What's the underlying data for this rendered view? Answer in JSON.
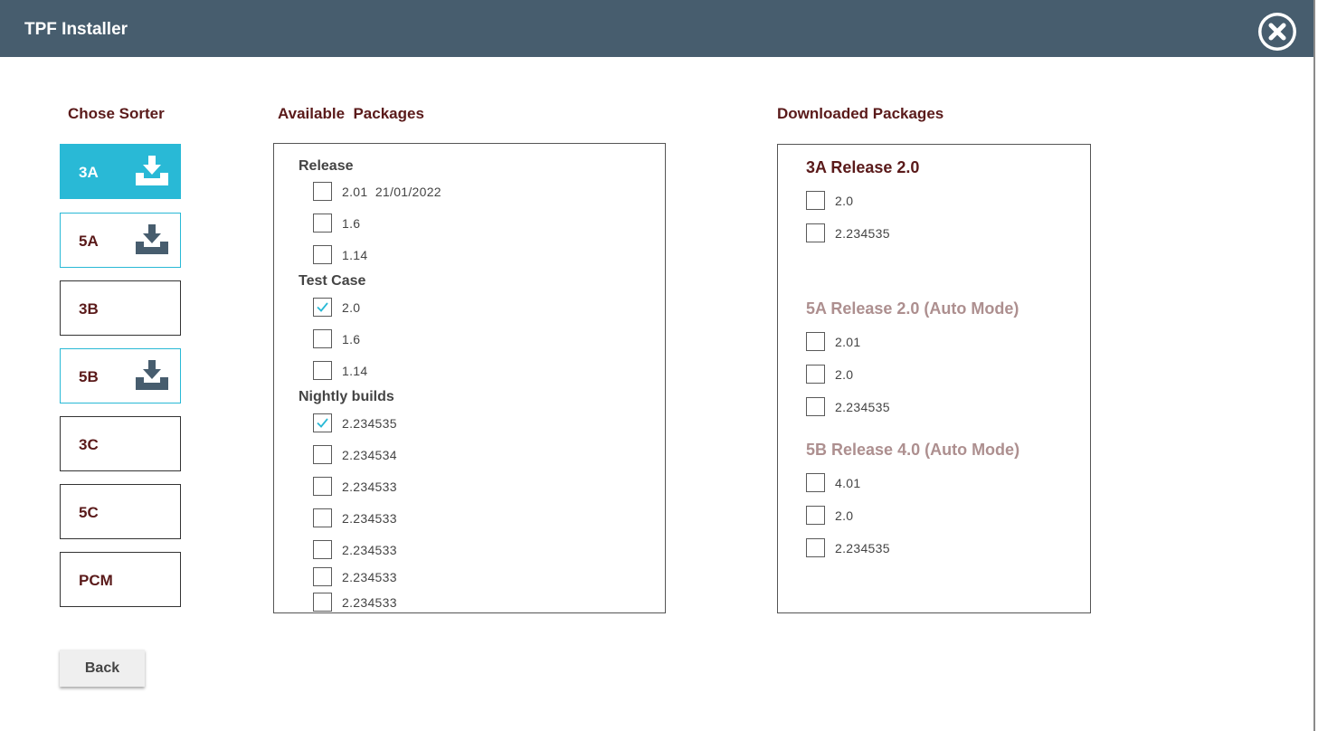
{
  "window": {
    "title": "TPF Installer"
  },
  "headings": {
    "sorter": "Chose Sorter",
    "available": "Available  Packages",
    "downloaded": "Downloaded Packages"
  },
  "sorters": [
    {
      "label": "3A",
      "download_icon": true,
      "state": "active"
    },
    {
      "label": "5A",
      "download_icon": true,
      "state": "downloadable"
    },
    {
      "label": "3B",
      "download_icon": false,
      "state": "normal"
    },
    {
      "label": "5B",
      "download_icon": true,
      "state": "downloadable"
    },
    {
      "label": "3C",
      "download_icon": false,
      "state": "normal"
    },
    {
      "label": "5C",
      "download_icon": false,
      "state": "normal"
    },
    {
      "label": "PCM",
      "download_icon": false,
      "state": "normal"
    }
  ],
  "available": {
    "release": {
      "label": "Release",
      "items": [
        {
          "label": "2.01  21/01/2022",
          "checked": false,
          "expand_icon": "chevron-down-icon"
        },
        {
          "label": "1.6",
          "checked": false,
          "expand_icon": "chevron-down-icon"
        },
        {
          "label": "1.14",
          "checked": false,
          "expand_icon": "chevron-down-icon"
        }
      ]
    },
    "test_case": {
      "label": "Test Case",
      "items": [
        {
          "label": "2.0",
          "checked": true
        },
        {
          "label": "1.6",
          "checked": false
        },
        {
          "label": "1.14",
          "checked": false
        }
      ]
    },
    "nightly": {
      "label": "Nightly builds",
      "items": [
        {
          "label": "2.234535",
          "checked": true
        },
        {
          "label": "2.234534",
          "checked": false
        },
        {
          "label": "2.234533",
          "checked": false
        },
        {
          "label": "2.234533",
          "checked": false
        },
        {
          "label": "2.234533",
          "checked": false
        },
        {
          "label": "2.234533",
          "checked": false
        },
        {
          "label": "2.234533",
          "checked": false
        }
      ]
    }
  },
  "downloaded": [
    {
      "title": "3A Release 2.0",
      "color": "#5a1a1a",
      "items": [
        {
          "label": "2.0",
          "checked": false
        },
        {
          "label": "2.234535",
          "checked": false
        }
      ]
    },
    {
      "title": "5A Release 2.0 (Auto Mode)",
      "color": "#ad8f8f",
      "items": [
        {
          "label": "2.01",
          "checked": false
        },
        {
          "label": "2.0",
          "checked": false
        },
        {
          "label": "2.234535",
          "checked": false
        }
      ]
    },
    {
      "title": "5B Release 4.0 (Auto Mode)",
      "color": "#ad8f8f",
      "items": [
        {
          "label": "4.01",
          "checked": false
        },
        {
          "label": "2.0",
          "checked": false
        },
        {
          "label": "2.234535",
          "checked": false
        }
      ]
    }
  ],
  "buttons": {
    "back": "Back",
    "close_icon": "close-circle-icon"
  },
  "colors": {
    "titlebar": "#475d6e",
    "accent": "#29b9d6",
    "heading_text": "#5a1a1a",
    "download_icon": "#475d6e"
  }
}
